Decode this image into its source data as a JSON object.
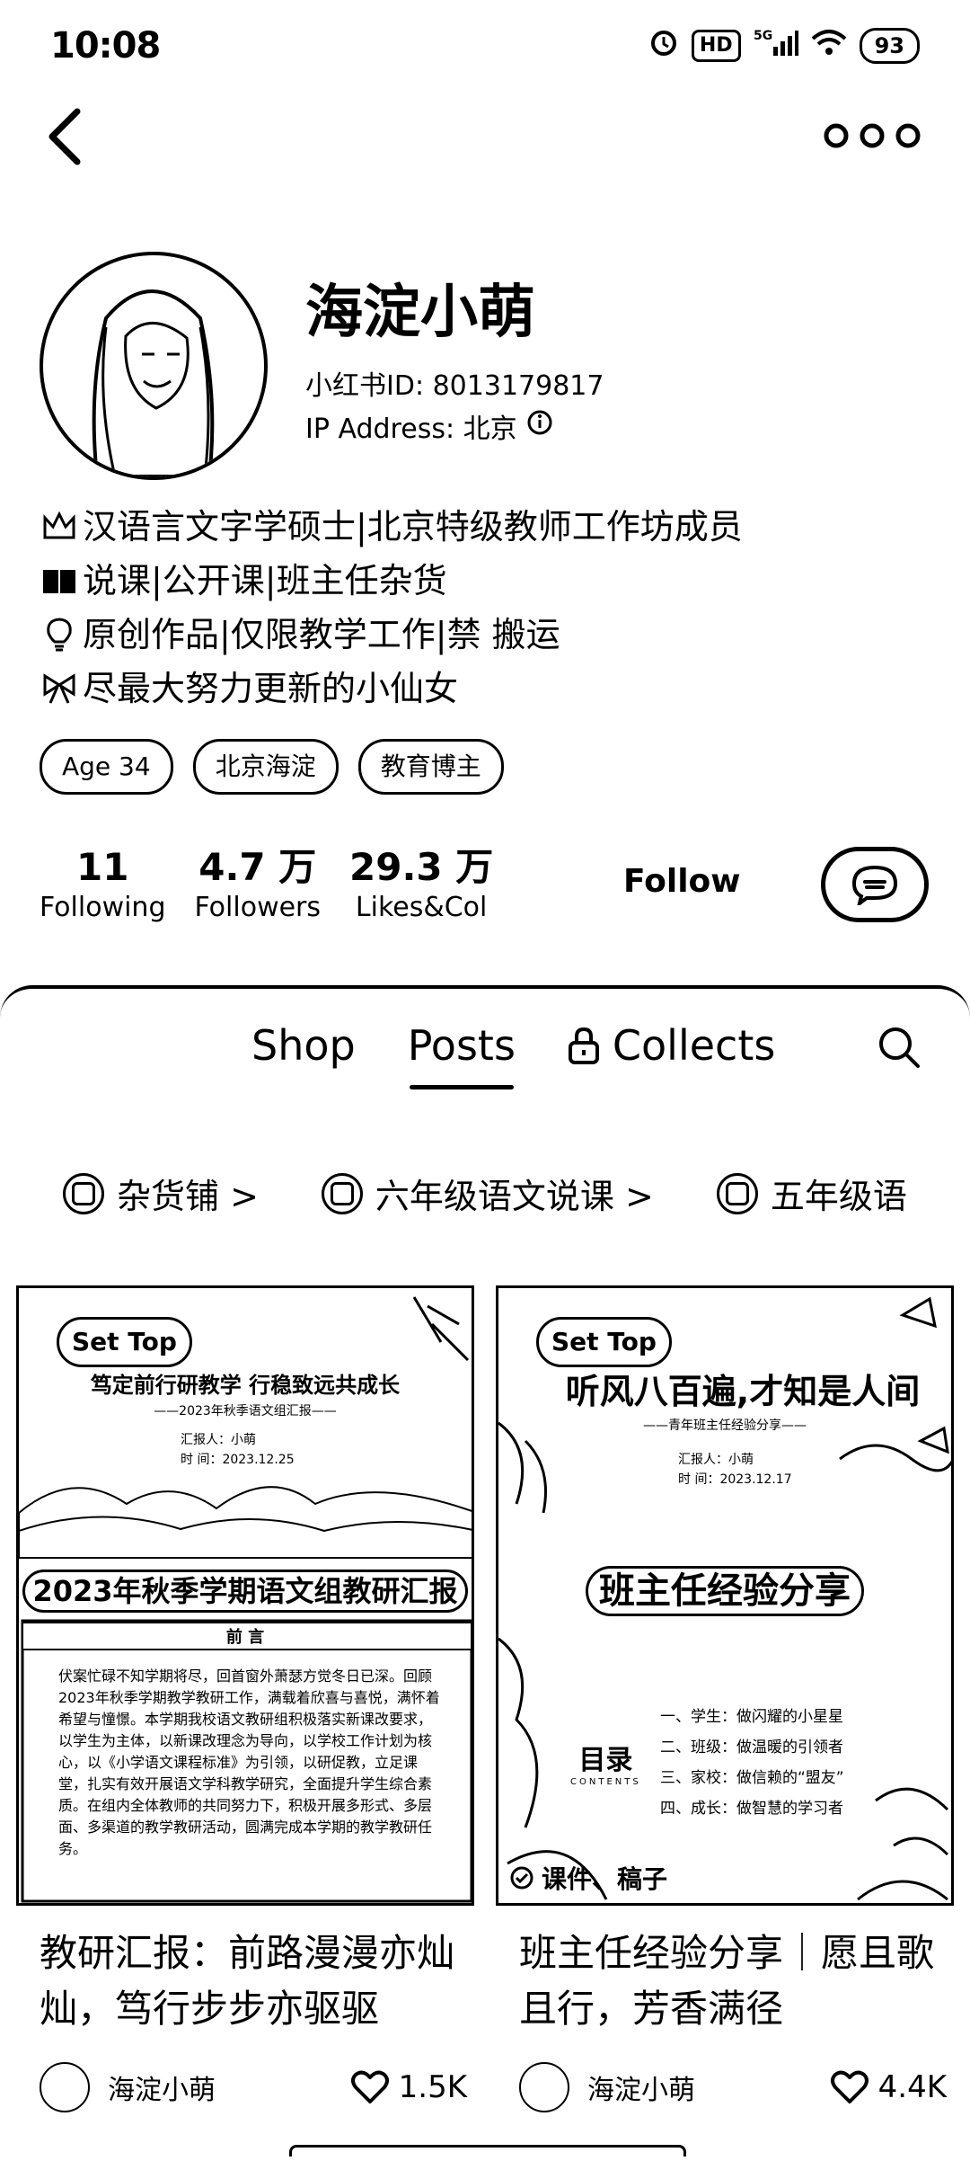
{
  "status": {
    "time": "10:08",
    "battery": "93"
  },
  "profile": {
    "name": "海淀小萌",
    "id_line": "小红书ID: 8013179817",
    "ip_line": "IP Address: 北京",
    "bio": [
      {
        "icon": "crown-icon",
        "text": "汉语言文字学硕士|北京特级教师工作坊成员"
      },
      {
        "icon": "book-icon",
        "text": "说课|公开课|班主任杂货"
      },
      {
        "icon": "lightbulb-icon",
        "text": "原创作品|仅限教学工作|禁 搬运"
      },
      {
        "icon": "bow-icon",
        "text": "尽最大努力更新的小仙女"
      }
    ],
    "tags": [
      "Age 34",
      "北京海淀",
      "教育博主"
    ],
    "stats": [
      {
        "num": "11",
        "label": "Following"
      },
      {
        "num": "4.7 万",
        "label": "Followers"
      },
      {
        "num": "29.3 万",
        "label": "Likes&Col"
      }
    ],
    "follow_label": "Follow"
  },
  "tabs": {
    "shop": "Shop",
    "posts": "Posts",
    "collects": "Collects"
  },
  "collections": [
    "杂货铺 >",
    "六年级语文说课 >",
    "五年级语"
  ],
  "posts": [
    {
      "settop": "Set Top",
      "img_heading": "笃定前行研教学  行稳致远共成长",
      "img_sub": "——2023年秋季语文组汇报——",
      "img_reporter": "汇报人：小萌",
      "img_date": "时  间：2023.12.25",
      "banner": "2023年秋季学期语文组教研汇报",
      "doc_title": "前 言",
      "doc_lines": "伏案忙碌不知学期将尽，回首窗外萧瑟方觉冬日已深。回顾2023年秋季学期教学教研工作，满载着欣喜与喜悦，满怀着希望与憧憬。本学期我校语文教研组积极落实新课改要求，以学生为主体，以新课改理念为导向，以学校工作计划为核心，以《小学语文课程标准》为引领，以研促教，立足课堂，扎实有效开展语文学科教学研究，全面提升学生综合素质。在组内全体教师的共同努力下，积极开展多形式、多层面、多渠道的教学教研活动，圆满完成本学期的教学教研任务。",
      "title": "教研汇报：前路漫漫亦灿灿，笃行步步亦驱驱",
      "author": "海淀小萌",
      "likes": "1.5K"
    },
    {
      "settop": "Set Top",
      "img_heading": "听风八百遍,才知是人间",
      "img_sub": "——青年班主任经验分享——",
      "img_reporter": "汇报人：小萌",
      "img_date": "时  间：2023.12.17",
      "banner": "班主任经验分享",
      "toc_title": "目录",
      "toc_sub": "CONTENTS",
      "toc_items": [
        "一、学生：做闪耀的小星星",
        "二、班级：做温暖的引领者",
        "三、家校：做信赖的“盟友”",
        "四、成长：做智慧的学习者"
      ],
      "bottom_label": "课件、稿子",
      "title": "班主任经验分享｜愿且歌且行，芳香满径",
      "author": "海淀小萌",
      "likes": "4.4K"
    }
  ]
}
